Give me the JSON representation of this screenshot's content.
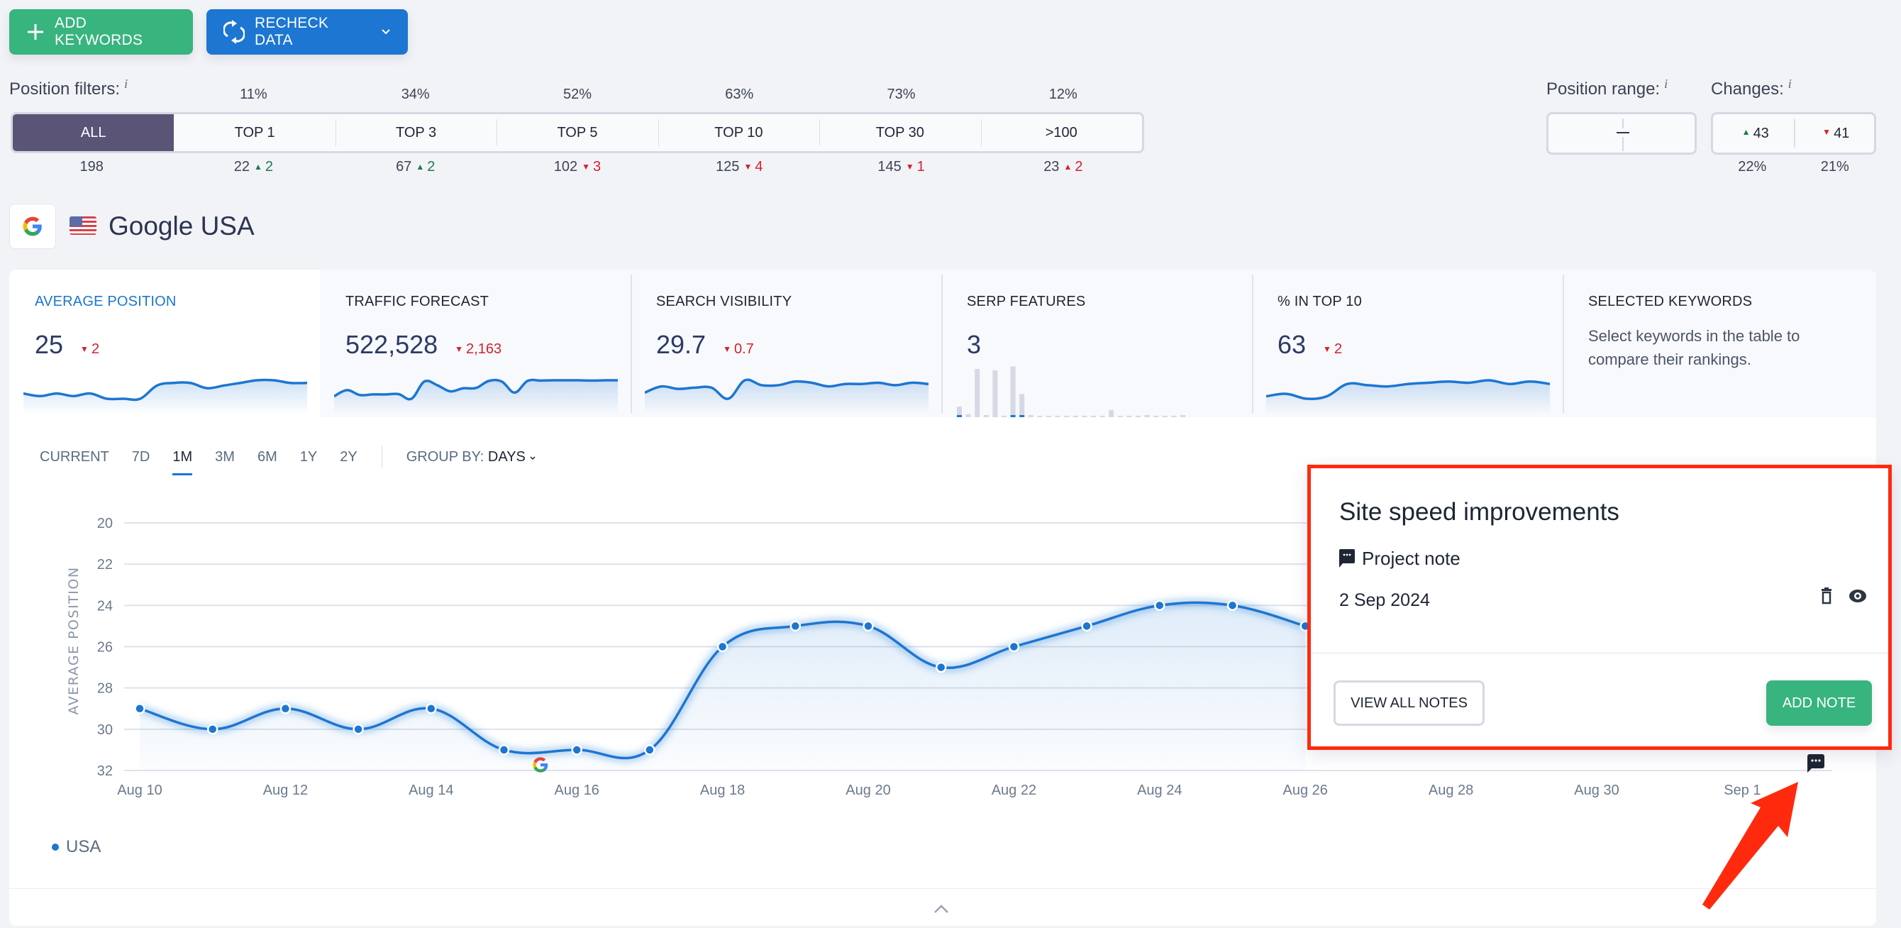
{
  "toolbar": {
    "add_keywords_label": "ADD KEYWORDS",
    "recheck_data_label": "RECHECK DATA"
  },
  "position_filters": {
    "label": "Position filters:",
    "info": "i",
    "segments": [
      {
        "label": "ALL",
        "percent": "",
        "count": "198",
        "delta": "",
        "delta_dir": ""
      },
      {
        "label": "TOP 1",
        "percent": "11%",
        "count": "22",
        "delta": "2",
        "delta_dir": "up"
      },
      {
        "label": "TOP 3",
        "percent": "34%",
        "count": "67",
        "delta": "2",
        "delta_dir": "up"
      },
      {
        "label": "TOP 5",
        "percent": "52%",
        "count": "102",
        "delta": "3",
        "delta_dir": "down"
      },
      {
        "label": "TOP 10",
        "percent": "63%",
        "count": "125",
        "delta": "4",
        "delta_dir": "down"
      },
      {
        "label": "TOP 30",
        "percent": "73%",
        "count": "145",
        "delta": "1",
        "delta_dir": "down"
      },
      {
        "label": ">100",
        "percent": "12%",
        "count": "23",
        "delta": "2",
        "delta_dir": "up-red"
      }
    ],
    "active": "ALL"
  },
  "position_range": {
    "label": "Position range:",
    "info": "i",
    "from": "",
    "to": ""
  },
  "changes": {
    "label": "Changes:",
    "info": "i",
    "up_count": "43",
    "down_count": "41",
    "up_percent": "22%",
    "down_percent": "21%"
  },
  "engine": {
    "name": "Google USA",
    "icon": "google-icon",
    "flag": "us-flag"
  },
  "metrics": [
    {
      "title": "AVERAGE POSITION",
      "value": "25",
      "delta": "2",
      "delta_dir": "down",
      "active": true
    },
    {
      "title": "TRAFFIC FORECAST",
      "value": "522,528",
      "delta": "2,163",
      "delta_dir": "down"
    },
    {
      "title": "SEARCH VISIBILITY",
      "value": "29.7",
      "delta": "0.7",
      "delta_dir": "down"
    },
    {
      "title": "SERP FEATURES",
      "value": "3",
      "delta": "",
      "delta_dir": ""
    },
    {
      "title": "% IN TOP 10",
      "value": "63",
      "delta": "2",
      "delta_dir": "down"
    },
    {
      "title": "SELECTED KEYWORDS",
      "text": "Select keywords in the table to compare their rankings."
    }
  ],
  "sparklines": {
    "average_position": [
      29,
      30,
      29,
      30,
      29,
      31,
      31,
      31,
      26,
      25,
      25,
      27,
      26,
      25,
      24,
      24,
      25,
      25
    ],
    "traffic_forecast": [
      70,
      90,
      74,
      76,
      76,
      77,
      62,
      118,
      106,
      86,
      96,
      97,
      120,
      118,
      82,
      120,
      121,
      122,
      122,
      122,
      121,
      122,
      122
    ],
    "search_visibility": [
      28.9,
      29.4,
      29.2,
      29.3,
      29.3,
      28.4,
      29.9,
      29.5,
      29.5,
      29.8,
      29.7,
      29.4,
      29.6,
      29.6,
      29.7,
      29.5,
      29.7,
      29.6
    ],
    "percent_top10": [
      62,
      62.2,
      61.8,
      62,
      63,
      62.9,
      62.8,
      63,
      63.1,
      63.2,
      63.1,
      63.3,
      63,
      63.2,
      63
    ],
    "serp_features": [
      0.22,
      0.06,
      1.0,
      0.04,
      0.97,
      0,
      1.05,
      0.48,
      0.04,
      0,
      0,
      0,
      0,
      0,
      0,
      0,
      0,
      0.15,
      0,
      0,
      0,
      0.02,
      0,
      0,
      0,
      0.02
    ]
  },
  "timeframe": {
    "tabs": [
      "CURRENT",
      "7D",
      "1M",
      "3M",
      "6M",
      "1Y",
      "2Y"
    ],
    "active": "1M",
    "group_by_label": "GROUP BY:",
    "group_by_value": "DAYS"
  },
  "chart_data": {
    "type": "line",
    "title": "",
    "xlabel": "",
    "ylabel": "AVERAGE POSITION",
    "ylim": [
      32,
      20
    ],
    "y_inverted": true,
    "yticks": [
      "20",
      "22",
      "24",
      "26",
      "28",
      "30",
      "32"
    ],
    "xticks": [
      "Aug 10",
      "Aug 12",
      "Aug 14",
      "Aug 16",
      "Aug 18",
      "Aug 20",
      "Aug 22",
      "Aug 24",
      "Aug 26",
      "Aug 28",
      "Aug 30",
      "Sep 1"
    ],
    "x": [
      "Aug 10",
      "Aug 11",
      "Aug 12",
      "Aug 13",
      "Aug 14",
      "Aug 15",
      "Aug 16",
      "Aug 17",
      "Aug 18",
      "Aug 19",
      "Aug 20",
      "Aug 21",
      "Aug 22",
      "Aug 23",
      "Aug 24",
      "Aug 25",
      "Aug 26"
    ],
    "series": [
      {
        "name": "USA",
        "color": "#1c76d2",
        "values": [
          29,
          30,
          29,
          30,
          29,
          31,
          31,
          31,
          26,
          25,
          25,
          27,
          26,
          25,
          24,
          24,
          25
        ]
      }
    ],
    "grid": true,
    "legend": "bottom-left",
    "annotations": [
      {
        "type": "google-update",
        "date": "Aug 15-16"
      },
      {
        "type": "project-note",
        "date": "Sep 2"
      }
    ]
  },
  "note_popup": {
    "title": "Site speed improvements",
    "type_label": "Project note",
    "date": "2 Sep 2024",
    "view_all_label": "VIEW ALL NOTES",
    "add_note_label": "ADD NOTE"
  },
  "colors": {
    "green": "#38b47f",
    "blue": "#1c76d2",
    "active_filter": "#5a5577",
    "up": "#1e7a4b",
    "down": "#d3212d",
    "highlight": "#ff2a0e"
  }
}
